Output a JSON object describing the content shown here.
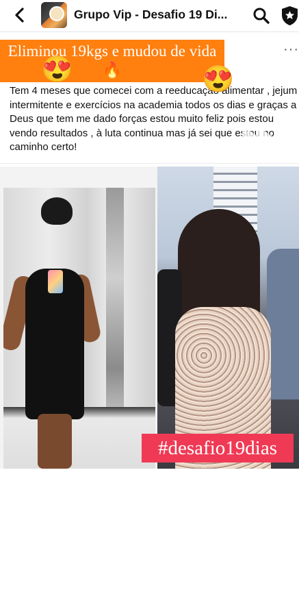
{
  "header": {
    "title": "Grupo Vip - Desafio 19 Di...",
    "icons": {
      "back": "back-arrow-icon",
      "search": "search-icon",
      "admin": "shield-star-icon"
    }
  },
  "post": {
    "headline": "Eliminou 19kgs e mudou de vida",
    "headline_emoji": "🔥",
    "more_label": "···",
    "text": "Tem 4 meses que comecei com a reeducação alimentar , jejum intermitente e exercícios na academia todos os dias e graças a Deus que tem me dado forças estou muito feliz pois estou vendo resultados , à luta continua mas já sei que estou no caminho certo!",
    "photo_emoji": "😍",
    "hashtag": "#desafio19dias"
  },
  "colors": {
    "headline_bg": "#ff7f0f",
    "hashtag_bg": "#f03a55"
  }
}
